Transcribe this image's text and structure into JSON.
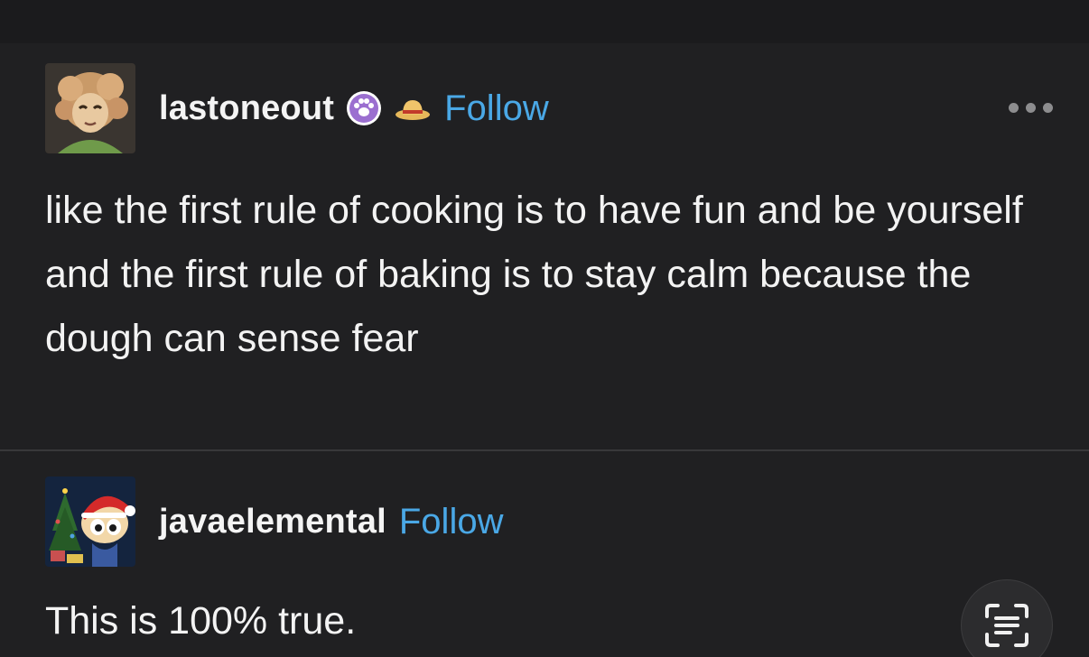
{
  "post": {
    "author": "lastoneout",
    "follow_label": "Follow",
    "avatar_icon": "curly-haired-character-avatar",
    "badges": [
      "paw-print-badge-icon",
      "straw-hat-icon"
    ],
    "more_icon": "more-options-icon",
    "text": "like the first rule of cooking is to have fun and be yourself and the first rule of baking is to stay calm because the dough can sense fear"
  },
  "reply": {
    "author": "javaelemental",
    "follow_label": "Follow",
    "avatar_icon": "santa-hat-character-avatar",
    "text": "This is 100% true."
  },
  "overlay": {
    "scan_icon": "live-text-scan-icon"
  },
  "colors": {
    "background": "#202022",
    "follow": "#4aa8e6",
    "text": "#f3f3f3"
  }
}
